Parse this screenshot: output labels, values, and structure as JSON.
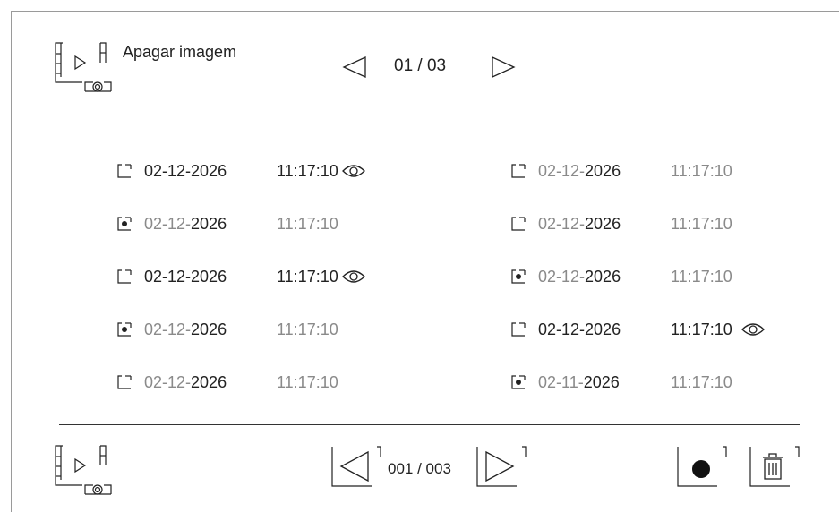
{
  "header": {
    "icon": "video-camera-icon",
    "title": "Apagar imagem",
    "page_indicator": "01 / 03",
    "prev_icon": "triangle-left-icon",
    "next_icon": "triangle-right-icon"
  },
  "records": [
    {
      "date_prefix": "02-12-",
      "date_year": "2026",
      "time": "11:17:10",
      "selected": false,
      "viewed": true,
      "emphasis": "dark"
    },
    {
      "date_prefix": "02-12-",
      "date_year": "2026",
      "time": "11:17:10",
      "selected": false,
      "viewed": false,
      "emphasis": "muted"
    },
    {
      "date_prefix": "02-12-",
      "date_year": "2026",
      "time": "11:17:10",
      "selected": true,
      "viewed": false,
      "emphasis": "muted"
    },
    {
      "date_prefix": "02-12-",
      "date_year": "2026",
      "time": "11:17:10",
      "selected": false,
      "viewed": false,
      "emphasis": "muted"
    },
    {
      "date_prefix": "02-12-",
      "date_year": "2026",
      "time": "11:17:10",
      "selected": false,
      "viewed": true,
      "emphasis": "dark"
    },
    {
      "date_prefix": "02-12-",
      "date_year": "2026",
      "time": "11:17:10",
      "selected": true,
      "viewed": false,
      "emphasis": "muted"
    },
    {
      "date_prefix": "02-12-",
      "date_year": "2026",
      "time": "11:17:10",
      "selected": true,
      "viewed": false,
      "emphasis": "muted"
    },
    {
      "date_prefix": "02-12-",
      "date_year": "2026",
      "time": "11:17:10",
      "selected": false,
      "viewed": true,
      "emphasis": "dark"
    },
    {
      "date_prefix": "02-12-",
      "date_year": "2026",
      "time": "11:17:10",
      "selected": false,
      "viewed": false,
      "emphasis": "muted"
    },
    {
      "date_prefix": "02-11-",
      "date_year": "2026",
      "time": "11:17:10",
      "selected": true,
      "viewed": false,
      "emphasis": "muted"
    }
  ],
  "footer": {
    "icon": "video-camera-icon",
    "page_indicator": "001 / 003",
    "prev_icon": "triangle-left-icon",
    "next_icon": "triangle-right-icon",
    "record_icon": "record-dot-icon",
    "delete_icon": "trash-icon"
  },
  "colors": {
    "text_dark": "#222222",
    "text_muted": "#8a8a8a",
    "frame": "#9a9a9a"
  }
}
